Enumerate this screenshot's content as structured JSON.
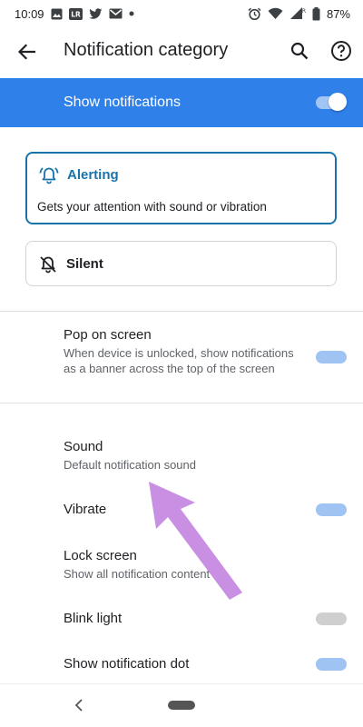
{
  "status_bar": {
    "time": "10:09",
    "battery_percent": "87%",
    "left_icons": [
      "image-icon",
      "lr-app-icon",
      "twitter-icon",
      "gmail-icon",
      "dot-icon"
    ],
    "right_icons": [
      "alarm-icon",
      "wifi-icon",
      "signal-icon",
      "battery-icon"
    ],
    "lr_label": "LR",
    "roaming_label": "R"
  },
  "app_bar": {
    "title": "Notification category"
  },
  "master_toggle": {
    "label": "Show notifications",
    "on": true
  },
  "behavior": {
    "alerting": {
      "title": "Alerting",
      "description": "Gets your attention with sound or vibration",
      "selected": true
    },
    "silent": {
      "title": "Silent",
      "selected": false
    }
  },
  "settings": [
    {
      "title": "Pop on screen",
      "subtitle": "When device is unlocked, show notifications as a banner across the top of the screen",
      "toggle": "on"
    },
    {
      "title": "Sound",
      "subtitle": "Default notification sound",
      "toggle": "none"
    },
    {
      "title": "Vibrate",
      "subtitle": "",
      "toggle": "on"
    },
    {
      "title": "Lock screen",
      "subtitle": "Show all notification content",
      "toggle": "none"
    },
    {
      "title": "Blink light",
      "subtitle": "",
      "toggle": "off"
    },
    {
      "title": "Show notification dot",
      "subtitle": "",
      "toggle": "on"
    }
  ],
  "colors": {
    "accent": "#1a73e8",
    "header_bar": "#2f80e8",
    "alerting": "#1a73a8",
    "annotation_arrow": "#c98fe3"
  }
}
